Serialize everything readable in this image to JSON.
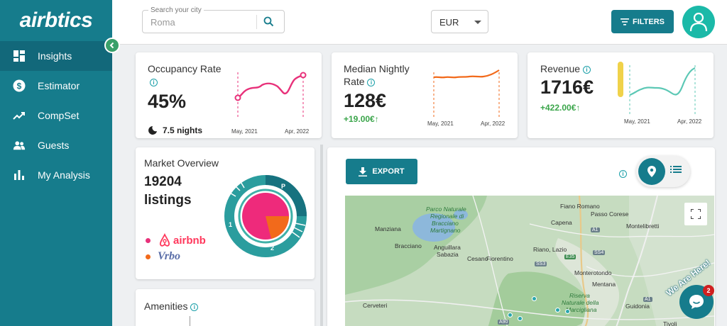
{
  "app": {
    "logo_text": "airbtics"
  },
  "sidebar": {
    "items": [
      {
        "label": "Insights",
        "icon": "dashboard-icon",
        "active": true
      },
      {
        "label": "Estimator",
        "icon": "dollar-icon",
        "active": false
      },
      {
        "label": "CompSet",
        "icon": "trending-up-icon",
        "active": false
      },
      {
        "label": "Guests",
        "icon": "people-icon",
        "active": false
      },
      {
        "label": "My Analysis",
        "icon": "bar-chart-icon",
        "active": false
      }
    ]
  },
  "header": {
    "search": {
      "label": "Search your city",
      "value": "Roma"
    },
    "currency": "EUR",
    "filters_label": "FILTERS"
  },
  "kpis": {
    "occupancy": {
      "title": "Occupancy Rate",
      "value": "45%",
      "nights": "7.5 nights",
      "x_start": "May, 2021",
      "x_end": "Apr, 2022",
      "color": "#e8317a"
    },
    "nightly": {
      "title_line1": "Median Nightly",
      "title_line2": "Rate",
      "value": "128€",
      "delta": "+19.00€↑",
      "x_start": "May, 2021",
      "x_end": "Apr, 2022",
      "color": "#f26a1b"
    },
    "revenue": {
      "title": "Revenue",
      "value": "1716€",
      "delta": "+422.00€↑",
      "x_start": "May, 2021",
      "x_end": "Apr, 2022",
      "color": "#5cc8b5"
    }
  },
  "market_overview": {
    "title": "Market Overview",
    "count": "19204",
    "unit": "listings",
    "donut_labels": {
      "outer": "P",
      "left": "1",
      "bottom": "2"
    },
    "legend": [
      {
        "label": "airbnb",
        "color": "#ff385c"
      },
      {
        "label": "Vrbo",
        "color": "#f26a1b"
      }
    ],
    "share": {
      "airbnb": 0.85,
      "vrbo": 0.15
    }
  },
  "amenities": {
    "title": "Amenities"
  },
  "map_panel": {
    "export_label": "EXPORT",
    "labels": [
      "Parco Naturale",
      "Regionale di",
      "Bracciano",
      "Martignano",
      "Fiano Romano",
      "Passo Corese",
      "Manziana",
      "Capena",
      "Montelibretti",
      "Bracciano",
      "Anguillara",
      "Sabazia",
      "Cesano",
      "Fiorentino",
      "Riano, Lazio",
      "Monterotondo",
      "Mentana",
      "Riserva",
      "Naturale della",
      "Marcigliana",
      "Cerveteri",
      "Guidonia",
      "Tivoli"
    ],
    "road_labels": [
      "A1",
      "SS4",
      "SS3",
      "E35",
      "A1",
      "A90"
    ]
  },
  "chat": {
    "badge": "2",
    "banner": "We Are Here!"
  }
}
